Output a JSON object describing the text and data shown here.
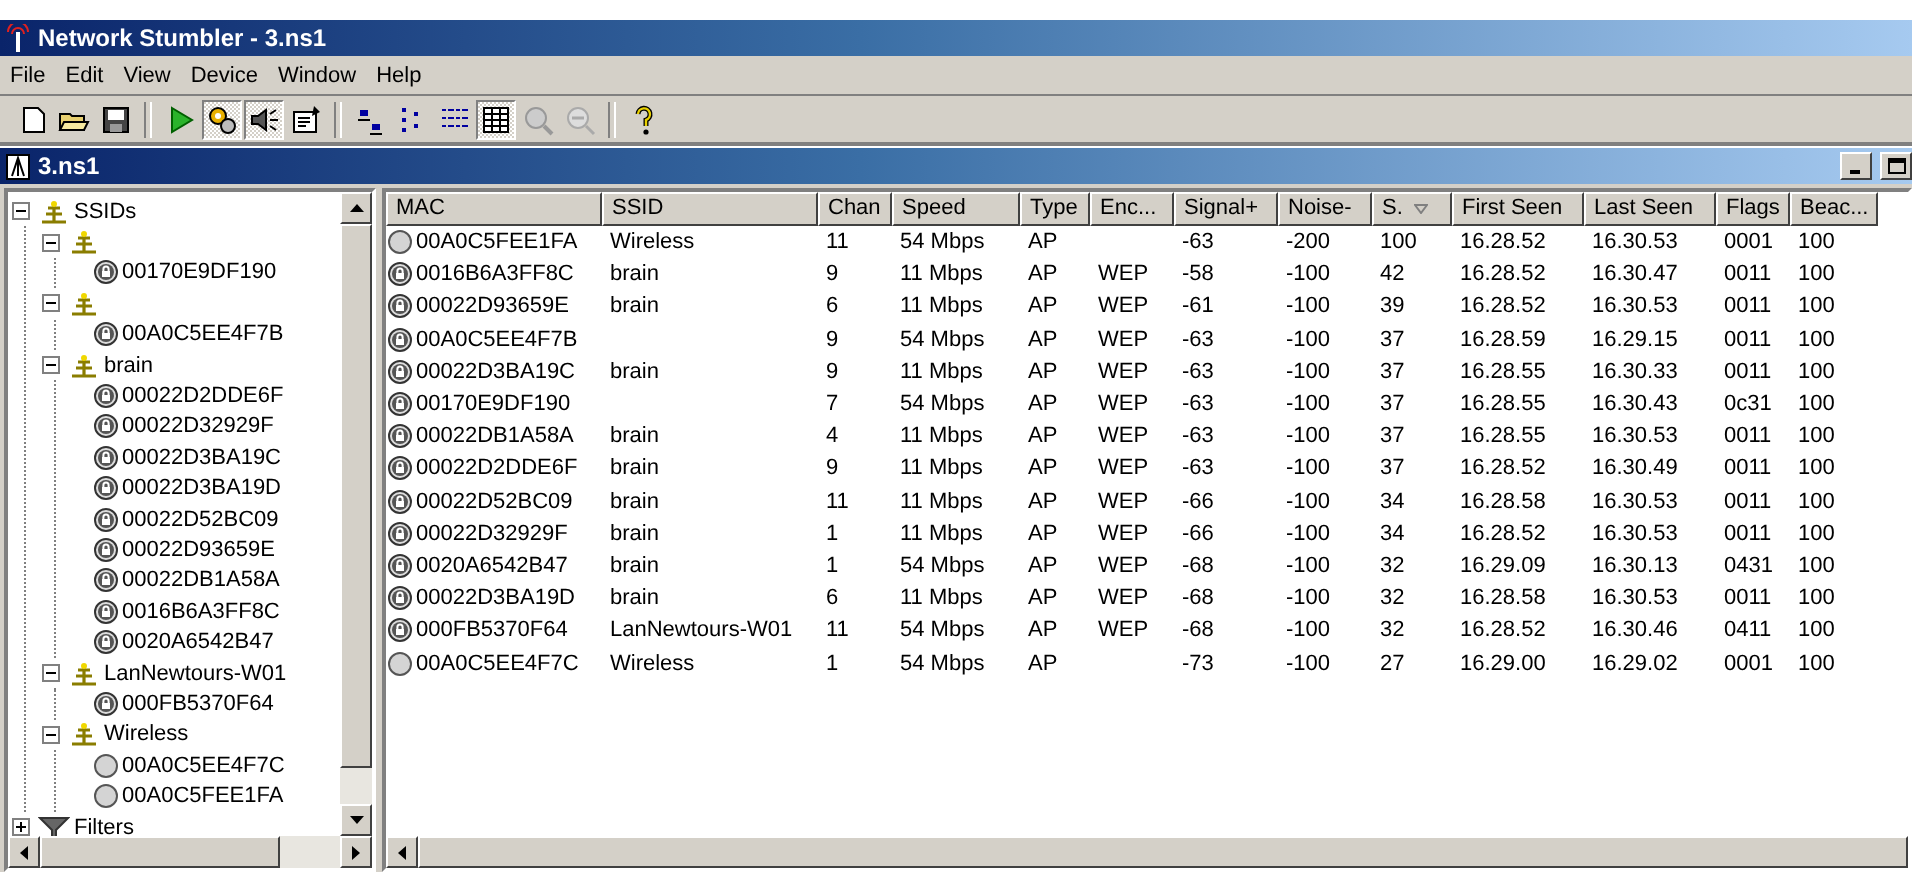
{
  "window": {
    "title": "Network Stumbler - 3.ns1"
  },
  "menu": [
    "File",
    "Edit",
    "View",
    "Device",
    "Window",
    "Help"
  ],
  "toolbar": [
    {
      "kind": "new",
      "pressed": false
    },
    {
      "kind": "open",
      "pressed": false
    },
    {
      "kind": "save",
      "pressed": false
    },
    {
      "kind": "sep"
    },
    {
      "kind": "play",
      "pressed": false
    },
    {
      "kind": "gear",
      "pressed": true
    },
    {
      "kind": "speaker",
      "pressed": true
    },
    {
      "kind": "props",
      "pressed": false
    },
    {
      "kind": "sep"
    },
    {
      "kind": "largeicons",
      "pressed": false
    },
    {
      "kind": "smallicons",
      "pressed": false
    },
    {
      "kind": "list",
      "pressed": false
    },
    {
      "kind": "details",
      "pressed": true
    },
    {
      "kind": "zoomin",
      "pressed": false
    },
    {
      "kind": "zoomout",
      "pressed": false
    },
    {
      "kind": "sep"
    },
    {
      "kind": "help",
      "pressed": false
    }
  ],
  "document": {
    "title": "3.ns1"
  },
  "tree": [
    {
      "label": "SSIDs",
      "kind": "ssid",
      "expanded": true,
      "children": [
        {
          "kind": "ssid",
          "expanded": true,
          "children": [
            {
              "label": "00170E9DF190",
              "kind": "ap",
              "locked": true
            }
          ]
        },
        {
          "kind": "ssid",
          "expanded": true,
          "children": [
            {
              "label": "00A0C5EE4F7B",
              "kind": "ap",
              "locked": true
            }
          ]
        },
        {
          "label": "brain",
          "kind": "ssid",
          "expanded": true,
          "children": [
            {
              "label": "00022D2DDE6F",
              "kind": "ap",
              "locked": true
            },
            {
              "label": "00022D32929F",
              "kind": "ap",
              "locked": true
            },
            {
              "label": "00022D3BA19C",
              "kind": "ap",
              "locked": true
            },
            {
              "label": "00022D3BA19D",
              "kind": "ap",
              "locked": true
            },
            {
              "label": "00022D52BC09",
              "kind": "ap",
              "locked": true
            },
            {
              "label": "00022D93659E",
              "kind": "ap",
              "locked": true
            },
            {
              "label": "00022DB1A58A",
              "kind": "ap",
              "locked": true
            },
            {
              "label": "0016B6A3FF8C",
              "kind": "ap",
              "locked": true
            },
            {
              "label": "0020A6542B47",
              "kind": "ap",
              "locked": true
            }
          ]
        },
        {
          "label": "LanNewtours-W01",
          "kind": "ssid",
          "expanded": true,
          "children": [
            {
              "label": "000FB5370F64",
              "kind": "ap",
              "locked": true
            }
          ]
        },
        {
          "label": "Wireless",
          "kind": "ssid",
          "expanded": true,
          "children": [
            {
              "label": "00A0C5EE4F7C",
              "kind": "ap",
              "locked": false
            },
            {
              "label": "00A0C5FEE1FA",
              "kind": "ap",
              "locked": false
            }
          ]
        }
      ]
    },
    {
      "label": "Filters",
      "kind": "filter",
      "expanded": false
    }
  ],
  "table": {
    "columns": [
      "MAC",
      "SSID",
      "Chan",
      "Speed",
      "Type",
      "Enc...",
      "Signal+",
      "Noise-",
      "S.",
      "First Seen",
      "Last Seen",
      "Flags",
      "Beac..."
    ],
    "rows": [
      {
        "locked": false,
        "cells": [
          "00A0C5FEE1FA",
          "Wireless",
          "11",
          "54 Mbps",
          "AP",
          "",
          "-63",
          "-200",
          "100",
          "16.28.52",
          "16.30.53",
          "0001",
          "100"
        ]
      },
      {
        "locked": true,
        "cells": [
          "0016B6A3FF8C",
          "brain",
          "9",
          "11 Mbps",
          "AP",
          "WEP",
          "-58",
          "-100",
          "42",
          "16.28.52",
          "16.30.47",
          "0011",
          "100"
        ]
      },
      {
        "locked": true,
        "cells": [
          "00022D93659E",
          "brain",
          "6",
          "11 Mbps",
          "AP",
          "WEP",
          "-61",
          "-100",
          "39",
          "16.28.52",
          "16.30.53",
          "0011",
          "100"
        ]
      },
      {
        "locked": true,
        "cells": [
          "00A0C5EE4F7B",
          "",
          "9",
          "54 Mbps",
          "AP",
          "WEP",
          "-63",
          "-100",
          "37",
          "16.28.59",
          "16.29.15",
          "0011",
          "100"
        ]
      },
      {
        "locked": true,
        "cells": [
          "00022D3BA19C",
          "brain",
          "9",
          "11 Mbps",
          "AP",
          "WEP",
          "-63",
          "-100",
          "37",
          "16.28.55",
          "16.30.33",
          "0011",
          "100"
        ]
      },
      {
        "locked": true,
        "cells": [
          "00170E9DF190",
          "",
          "7",
          "54 Mbps",
          "AP",
          "WEP",
          "-63",
          "-100",
          "37",
          "16.28.55",
          "16.30.43",
          "0c31",
          "100"
        ]
      },
      {
        "locked": true,
        "cells": [
          "00022DB1A58A",
          "brain",
          "4",
          "11 Mbps",
          "AP",
          "WEP",
          "-63",
          "-100",
          "37",
          "16.28.55",
          "16.30.53",
          "0011",
          "100"
        ]
      },
      {
        "locked": true,
        "cells": [
          "00022D2DDE6F",
          "brain",
          "9",
          "11 Mbps",
          "AP",
          "WEP",
          "-63",
          "-100",
          "37",
          "16.28.52",
          "16.30.49",
          "0011",
          "100"
        ]
      },
      {
        "locked": true,
        "cells": [
          "00022D52BC09",
          "brain",
          "11",
          "11 Mbps",
          "AP",
          "WEP",
          "-66",
          "-100",
          "34",
          "16.28.58",
          "16.30.53",
          "0011",
          "100"
        ]
      },
      {
        "locked": true,
        "cells": [
          "00022D32929F",
          "brain",
          "1",
          "11 Mbps",
          "AP",
          "WEP",
          "-66",
          "-100",
          "34",
          "16.28.52",
          "16.30.53",
          "0011",
          "100"
        ]
      },
      {
        "locked": true,
        "cells": [
          "0020A6542B47",
          "brain",
          "1",
          "54 Mbps",
          "AP",
          "WEP",
          "-68",
          "-100",
          "32",
          "16.29.09",
          "16.30.13",
          "0431",
          "100"
        ]
      },
      {
        "locked": true,
        "cells": [
          "00022D3BA19D",
          "brain",
          "6",
          "11 Mbps",
          "AP",
          "WEP",
          "-68",
          "-100",
          "32",
          "16.28.58",
          "16.30.53",
          "0011",
          "100"
        ]
      },
      {
        "locked": true,
        "cells": [
          "000FB5370F64",
          "LanNewtours-W01",
          "11",
          "54 Mbps",
          "AP",
          "WEP",
          "-68",
          "-100",
          "32",
          "16.28.52",
          "16.30.46",
          "0411",
          "100"
        ]
      },
      {
        "locked": false,
        "cells": [
          "00A0C5EE4F7C",
          "Wireless",
          "1",
          "54 Mbps",
          "AP",
          "",
          "-73",
          "-100",
          "27",
          "16.29.00",
          "16.29.02",
          "0001",
          "100"
        ]
      }
    ]
  }
}
